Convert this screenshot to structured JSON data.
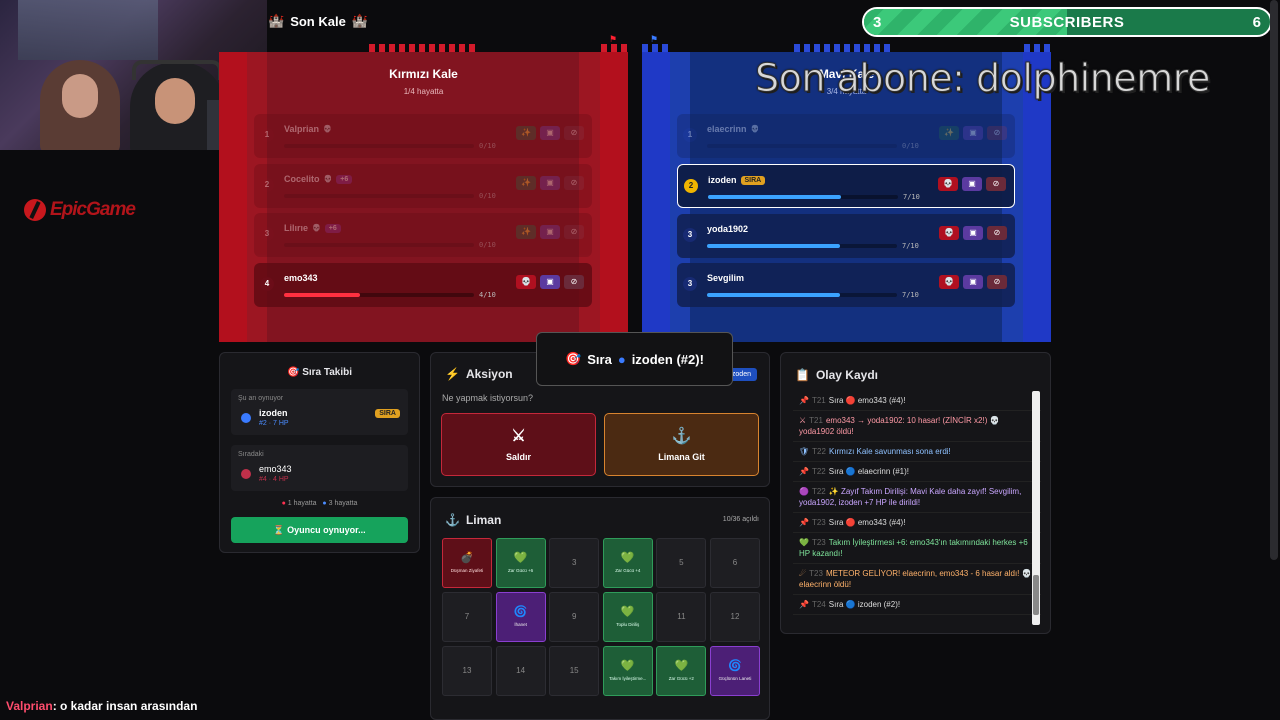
{
  "game_title": "Son Kale",
  "subscribers": {
    "current": "3",
    "label": "SUBSCRIBERS",
    "goal": "6",
    "progress_pct": 50
  },
  "last_sub": "Son abone: dolphinemre",
  "logo_text": "EpicGame",
  "red": {
    "name": "Kırmızı Kale",
    "status": "1/4 hayatta",
    "players": [
      {
        "num": "1",
        "name": "Valprian",
        "bonus": "",
        "hp": "0/10",
        "hp_pct": 0,
        "dead": true
      },
      {
        "num": "2",
        "name": "Cocelito",
        "bonus": "+6",
        "hp": "0/10",
        "hp_pct": 0,
        "dead": true
      },
      {
        "num": "3",
        "name": "Lilırıe",
        "bonus": "+6",
        "hp": "0/10",
        "hp_pct": 0,
        "dead": true
      },
      {
        "num": "4",
        "name": "emo343",
        "bonus": "",
        "hp": "4/10",
        "hp_pct": 40,
        "dead": false
      }
    ]
  },
  "blue": {
    "name": "Mavi Kale",
    "status": "3/4 hayatta",
    "players": [
      {
        "num": "1",
        "name": "elaecrinn",
        "hp": "0/10",
        "hp_pct": 0,
        "dead": true
      },
      {
        "num": "2",
        "name": "izoden",
        "tag": "SIRA",
        "hp": "7/10",
        "hp_pct": 70,
        "current": true
      },
      {
        "num": "3",
        "name": "yoda1902",
        "hp": "7/10",
        "hp_pct": 70
      },
      {
        "num": "3",
        "name": "Sevgilim",
        "hp": "7/10",
        "hp_pct": 70
      }
    ]
  },
  "turn_tracker": {
    "title": "Sıra Takibi",
    "now_label": "Şu an oynuyor",
    "now_name": "izoden",
    "now_sub": "#2 · 7 HP",
    "now_tag": "SIRA",
    "next_label": "Sıradaki",
    "next_name": "emo343",
    "next_sub": "#4 · 4 HP",
    "alive_red": "1 hayatta",
    "alive_blue": "3 hayatta",
    "button": "Oyuncu oynuyor..."
  },
  "action": {
    "title": "Aksiyon",
    "question": "Ne yapmak istiyorsun?",
    "chip": "izoden",
    "attack": "Saldır",
    "port": "Limana Git"
  },
  "toast": {
    "prefix": "Sıra",
    "name": "izoden (#2)!"
  },
  "port": {
    "title": "Liman",
    "count": "10/36 açıldı",
    "cells": [
      {
        "n": "",
        "label": "Düşman Ziyafeti",
        "kind": "r",
        "icon": "💣"
      },
      {
        "n": "",
        "label": "Zar Gücü +6",
        "kind": "g",
        "icon": "💚"
      },
      {
        "n": "3",
        "label": "",
        "kind": "",
        "icon": ""
      },
      {
        "n": "",
        "label": "Zar Gücü +4",
        "kind": "g",
        "icon": "💚"
      },
      {
        "n": "5",
        "label": "",
        "kind": "",
        "icon": ""
      },
      {
        "n": "6",
        "label": "",
        "kind": "",
        "icon": ""
      },
      {
        "n": "7",
        "label": "",
        "kind": "",
        "icon": ""
      },
      {
        "n": "",
        "label": "İhanet",
        "kind": "p",
        "icon": "🌀"
      },
      {
        "n": "9",
        "label": "",
        "kind": "",
        "icon": ""
      },
      {
        "n": "",
        "label": "Toplu Diriliş",
        "kind": "g",
        "icon": "💚"
      },
      {
        "n": "11",
        "label": "",
        "kind": "",
        "icon": ""
      },
      {
        "n": "12",
        "label": "",
        "kind": "",
        "icon": ""
      },
      {
        "n": "13",
        "label": "",
        "kind": "",
        "icon": ""
      },
      {
        "n": "14",
        "label": "",
        "kind": "",
        "icon": ""
      },
      {
        "n": "15",
        "label": "",
        "kind": "",
        "icon": ""
      },
      {
        "n": "",
        "label": "Takım İyileştirme...",
        "kind": "g",
        "icon": "💚"
      },
      {
        "n": "",
        "label": "Zar Gücü +2",
        "kind": "g",
        "icon": "💚"
      },
      {
        "n": "",
        "label": "Güçlünün Laneti",
        "kind": "p",
        "icon": "🌀"
      }
    ]
  },
  "log": {
    "title": "Olay Kaydı",
    "events": [
      {
        "cls": "",
        "icon": "📌",
        "t": "T21",
        "text": "Sıra 🔴 emo343 (#4)!"
      },
      {
        "cls": "red",
        "icon": "⚔",
        "t": "T21",
        "text": "emo343 → yoda1902: 10 hasar! (ZİNCİR x2!) 💀 yoda1902 öldü!"
      },
      {
        "cls": "blue",
        "icon": "🛡",
        "t": "T22",
        "text": "Kırmızı Kale savunması sona erdi!"
      },
      {
        "cls": "",
        "icon": "📌",
        "t": "T22",
        "text": "Sıra 🔵 elaecrinn (#1)!"
      },
      {
        "cls": "purple",
        "icon": "🟣",
        "t": "T22",
        "text": "✨ Zayıf Takım Dirilişi: Mavi Kale daha zayıf! Sevgilim, yoda1902, izoden +7 HP ile dirildi!"
      },
      {
        "cls": "",
        "icon": "📌",
        "t": "T23",
        "text": "Sıra 🔴 emo343 (#4)!"
      },
      {
        "cls": "green",
        "icon": "💚",
        "t": "T23",
        "text": "Takım İyileştirmesi +6: emo343'ın takımındaki herkes +6 HP kazandı!"
      },
      {
        "cls": "orange",
        "icon": "☄",
        "t": "T23",
        "text": "METEOR GELİYOR! elaecrinn, emo343 - 6 hasar aldı! 💀 elaecrinn öldü!"
      },
      {
        "cls": "",
        "icon": "📌",
        "t": "T24",
        "text": "Sıra 🔵 izoden (#2)!"
      }
    ]
  },
  "chat": {
    "user": "Valprian",
    "message": ": o kadar insan arasından"
  }
}
